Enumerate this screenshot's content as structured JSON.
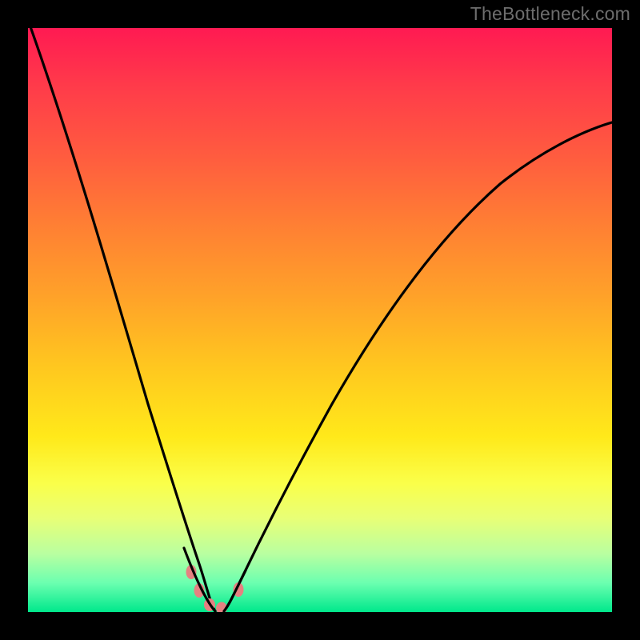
{
  "watermark": "TheBottleneck.com",
  "chart_data": {
    "type": "line",
    "title": "",
    "subtitle": "",
    "xlabel": "",
    "ylabel": "",
    "xlim": [
      0,
      100
    ],
    "ylim": [
      0,
      100
    ],
    "grid": false,
    "legend": false,
    "series": [
      {
        "name": "left-curve",
        "x": [
          0,
          2,
          4,
          6,
          8,
          10,
          12,
          14,
          16,
          18,
          20,
          22,
          24,
          26,
          28,
          30
        ],
        "y": [
          100,
          85,
          71,
          58,
          47,
          37,
          29,
          22,
          16,
          11,
          7.5,
          4.8,
          2.8,
          1.3,
          0.4,
          0
        ]
      },
      {
        "name": "right-curve",
        "x": [
          34,
          36,
          38,
          40,
          44,
          48,
          52,
          56,
          60,
          64,
          68,
          72,
          76,
          80,
          84,
          88,
          92,
          96,
          100
        ],
        "y": [
          0,
          1.4,
          3.5,
          6,
          12,
          19,
          26,
          33,
          39.5,
          46,
          52,
          57.5,
          62.5,
          67,
          71,
          74.5,
          77.5,
          80.5,
          83
        ]
      }
    ],
    "marker_points": [
      {
        "x": 27,
        "y": 7
      },
      {
        "x": 28.5,
        "y": 3.5
      },
      {
        "x": 30.5,
        "y": 1
      },
      {
        "x": 32.5,
        "y": 0.5
      },
      {
        "x": 35.5,
        "y": 3.5
      }
    ],
    "colors": {
      "line": "#000000",
      "marker": "#e58181",
      "gradient_top": "#ff1a52",
      "gradient_bottom": "#00e88c"
    }
  }
}
